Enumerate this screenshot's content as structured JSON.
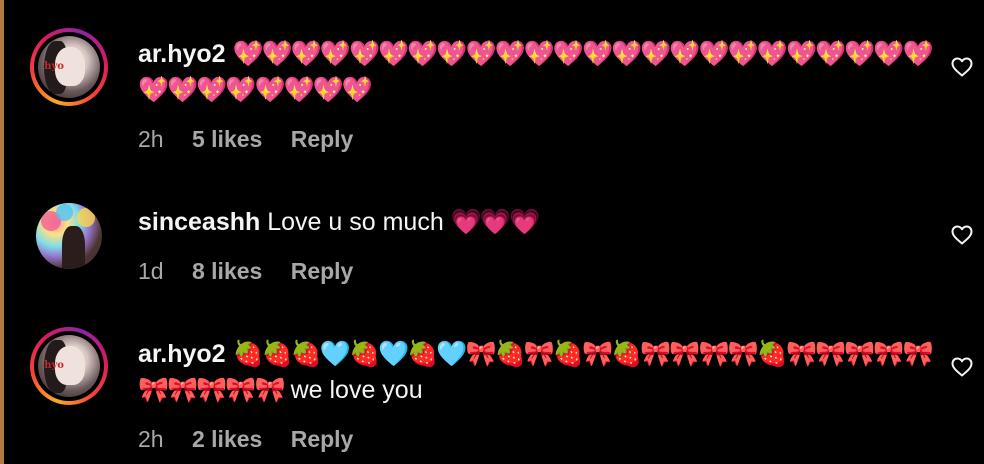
{
  "comments": [
    {
      "username": "ar.hyo2",
      "text_line1": "💖💖💖💖💖💖💖💖💖💖💖💖💖💖💖💖💖💖💖💖💖💖💖💖",
      "text_line2": "💖💖💖💖💖💖💖💖",
      "time": "2h",
      "likes": "5 likes",
      "reply": "Reply"
    },
    {
      "username": "sinceashh",
      "text_line1": "Love u so much",
      "emoji": "💗💗💗",
      "time": "1d",
      "likes": "8 likes",
      "reply": "Reply"
    },
    {
      "username": "ar.hyo2",
      "text_line1": "🍓🍓🍓🩵🍓🩵🍓🩵🎀🍓🎀🍓🎀🍓🎀🎀🎀🎀🍓🎀🎀🎀🎀🎀",
      "text_line2_emoji": "🎀🎀🎀🎀🎀",
      "text_line2": "we love you",
      "time": "2h",
      "likes": "2 likes",
      "reply": "Reply"
    }
  ],
  "icons": {
    "like": "heart-outline-icon"
  },
  "colors": {
    "background": "#000000",
    "text": "#f5f5f5",
    "meta": "#a8a8a8",
    "left_edge": "#b07a45"
  }
}
